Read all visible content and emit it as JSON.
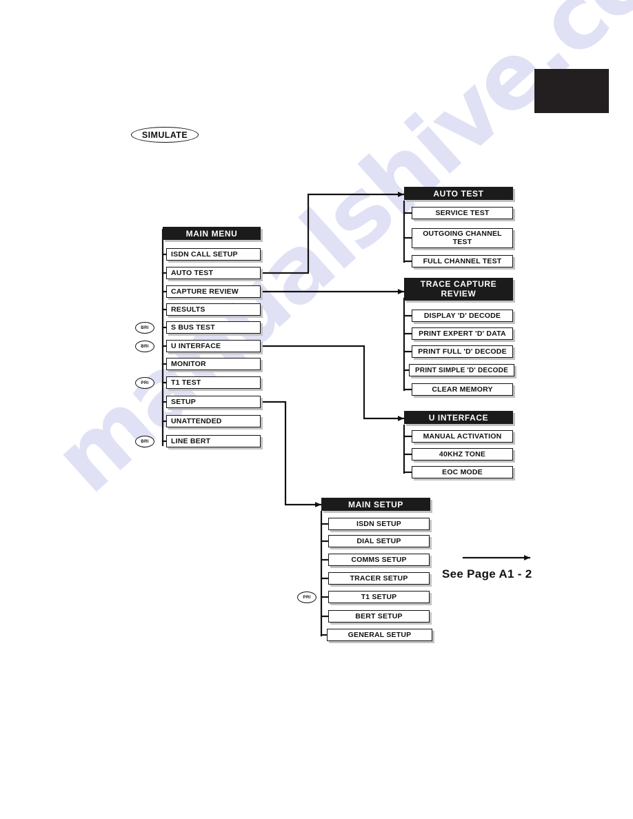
{
  "page": {
    "watermark_text": "manualshive.com",
    "corner_block_color": "#231f20",
    "header_fill": "#1b1b1b",
    "box_border": "#111111",
    "shadow_color": "#c2c2c2"
  },
  "simulate_badge": {
    "label": "SIMULATE"
  },
  "see_page_note": {
    "label": "See Page A1 - 2"
  },
  "tags": {
    "bri": "BRI",
    "pri": "PRI"
  },
  "main_menu": {
    "title": "MAIN MENU",
    "items": [
      {
        "label": "ISDN CALL SETUP",
        "tag": ""
      },
      {
        "label": "AUTO TEST",
        "tag": ""
      },
      {
        "label": "CAPTURE REVIEW",
        "tag": ""
      },
      {
        "label": "RESULTS",
        "tag": ""
      },
      {
        "label": "S BUS TEST",
        "tag": "BRI"
      },
      {
        "label": "U INTERFACE",
        "tag": "BRI"
      },
      {
        "label": "MONITOR",
        "tag": ""
      },
      {
        "label": "T1 TEST",
        "tag": "PRI"
      },
      {
        "label": "SETUP",
        "tag": ""
      },
      {
        "label": "UNATTENDED",
        "tag": ""
      },
      {
        "label": "LINE BERT",
        "tag": "BRI"
      }
    ]
  },
  "auto_test": {
    "title": "AUTO TEST",
    "items": [
      {
        "label": "SERVICE TEST"
      },
      {
        "label": "OUTGOING CHANNEL TEST"
      },
      {
        "label": "FULL CHANNEL TEST"
      }
    ]
  },
  "trace_capture_review": {
    "title": "TRACE CAPTURE REVIEW",
    "items": [
      {
        "label": "DISPLAY 'D' DECODE"
      },
      {
        "label": "PRINT EXPERT 'D' DATA"
      },
      {
        "label": "PRINT FULL 'D' DECODE"
      },
      {
        "label": "PRINT SIMPLE 'D' DECODE"
      },
      {
        "label": "CLEAR MEMORY"
      }
    ]
  },
  "u_interface": {
    "title": "U INTERFACE",
    "items": [
      {
        "label": "MANUAL ACTIVATION"
      },
      {
        "label": "40KHZ TONE"
      },
      {
        "label": "EOC MODE"
      }
    ]
  },
  "main_setup": {
    "title": "MAIN SETUP",
    "items": [
      {
        "label": "ISDN SETUP",
        "tag": ""
      },
      {
        "label": "DIAL  SETUP",
        "tag": ""
      },
      {
        "label": "COMMS  SETUP",
        "tag": ""
      },
      {
        "label": "TRACER SETUP",
        "tag": ""
      },
      {
        "label": "T1 SETUP",
        "tag": "PRI"
      },
      {
        "label": "BERT SETUP",
        "tag": ""
      },
      {
        "label": "GENERAL  SETUP",
        "tag": ""
      }
    ]
  }
}
